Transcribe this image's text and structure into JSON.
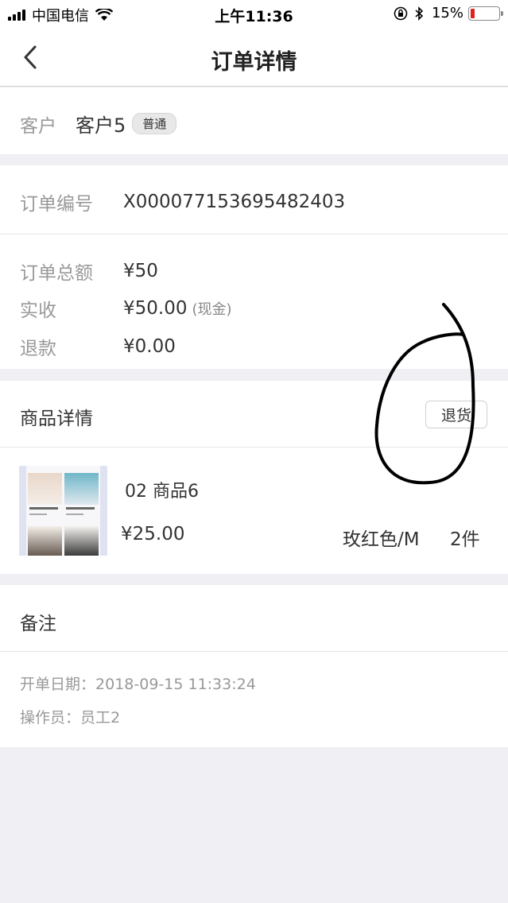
{
  "status_bar": {
    "carrier": "中国电信",
    "time": "上午11:36",
    "battery_text": "15%",
    "battery_level": 0.15
  },
  "nav": {
    "title": "订单详情"
  },
  "customer": {
    "label": "客户",
    "name": "客户5",
    "tag": "普通"
  },
  "order": {
    "number_label": "订单编号",
    "number": "X000077153695482403",
    "total_label": "订单总额",
    "total": "¥50",
    "received_label": "实收",
    "received": "¥50.00",
    "received_method": "(现金)",
    "refund_label": "退款",
    "refund": "¥0.00"
  },
  "goods": {
    "title": "商品详情",
    "return_button": "退货",
    "items": [
      {
        "name": "02 商品6",
        "price": "¥25.00",
        "spec": "玫红色/M",
        "qty": "2件"
      }
    ]
  },
  "remark": {
    "title": "备注",
    "open_date_label": "开单日期：",
    "open_date": "2018-09-15 11:33:24",
    "operator_label": "操作员：",
    "operator": "员工2"
  },
  "colors": {
    "background": "#efeff4",
    "card": "#ffffff",
    "label": "#999999",
    "text": "#333333",
    "battery_low": "#e02020"
  }
}
